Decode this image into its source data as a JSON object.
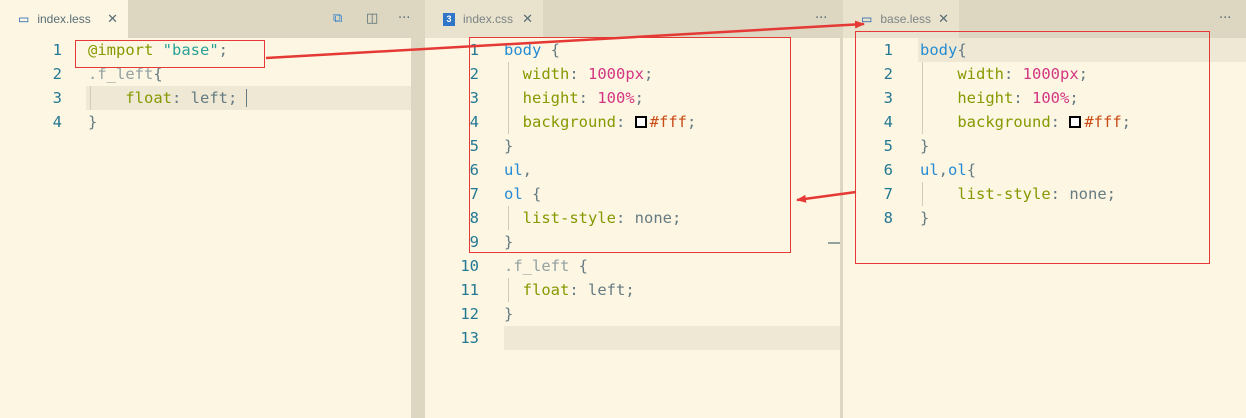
{
  "panes": [
    {
      "tab": {
        "label": "index.less",
        "icon": "less-file-icon"
      },
      "actions": [
        "compare-icon",
        "split-editor-icon",
        "more-actions-icon"
      ],
      "lines": [
        {
          "n": "1",
          "tokens": [
            [
              "at",
              "@import"
            ],
            [
              "plain",
              " "
            ],
            [
              "str",
              "\"base\""
            ],
            [
              "plain",
              ";"
            ]
          ]
        },
        {
          "n": "2",
          "tokens": [
            [
              "cls",
              ".f_left"
            ],
            [
              "plain",
              "{"
            ]
          ]
        },
        {
          "n": "3",
          "tokens": [
            [
              "plain",
              "    "
            ],
            [
              "prop",
              "float"
            ],
            [
              "plain",
              ": left;"
            ]
          ]
        },
        {
          "n": "4",
          "tokens": [
            [
              "plain",
              "}"
            ]
          ]
        }
      ]
    },
    {
      "tab": {
        "label": "index.css",
        "icon": "css-file-icon"
      },
      "actions": [
        "more-actions-icon"
      ],
      "lines": [
        {
          "n": "1",
          "tokens": [
            [
              "kw",
              "body"
            ],
            [
              "plain",
              " {"
            ]
          ]
        },
        {
          "n": "2",
          "tokens": [
            [
              "plain",
              "  "
            ],
            [
              "prop",
              "width"
            ],
            [
              "plain",
              ": "
            ],
            [
              "num",
              "1000px"
            ],
            [
              "plain",
              ";"
            ]
          ]
        },
        {
          "n": "3",
          "tokens": [
            [
              "plain",
              "  "
            ],
            [
              "prop",
              "height"
            ],
            [
              "plain",
              ": "
            ],
            [
              "num",
              "100%"
            ],
            [
              "plain",
              ";"
            ]
          ]
        },
        {
          "n": "4",
          "tokens": [
            [
              "plain",
              "  "
            ],
            [
              "prop",
              "background"
            ],
            [
              "plain",
              ": "
            ],
            [
              "swatch",
              ""
            ],
            [
              "hex",
              "#fff"
            ],
            [
              "plain",
              ";"
            ]
          ]
        },
        {
          "n": "5",
          "tokens": [
            [
              "plain",
              "}"
            ]
          ]
        },
        {
          "n": "6",
          "tokens": [
            [
              "kw",
              "ul"
            ],
            [
              "plain",
              ","
            ]
          ]
        },
        {
          "n": "7",
          "tokens": [
            [
              "kw",
              "ol"
            ],
            [
              "plain",
              " {"
            ]
          ]
        },
        {
          "n": "8",
          "tokens": [
            [
              "plain",
              "  "
            ],
            [
              "prop",
              "list-style"
            ],
            [
              "plain",
              ": none;"
            ]
          ]
        },
        {
          "n": "9",
          "tokens": [
            [
              "plain",
              "}"
            ]
          ]
        },
        {
          "n": "10",
          "tokens": [
            [
              "cls",
              ".f_left"
            ],
            [
              "plain",
              " {"
            ]
          ]
        },
        {
          "n": "11",
          "tokens": [
            [
              "plain",
              "  "
            ],
            [
              "prop",
              "float"
            ],
            [
              "plain",
              ": left;"
            ]
          ]
        },
        {
          "n": "12",
          "tokens": [
            [
              "plain",
              "}"
            ]
          ]
        },
        {
          "n": "13",
          "tokens": []
        }
      ]
    },
    {
      "tab": {
        "label": "base.less",
        "icon": "less-file-icon"
      },
      "actions": [
        "more-actions-icon"
      ],
      "lines": [
        {
          "n": "1",
          "tokens": [
            [
              "kw",
              "body"
            ],
            [
              "plain",
              "{"
            ]
          ]
        },
        {
          "n": "2",
          "tokens": [
            [
              "plain",
              "    "
            ],
            [
              "prop",
              "width"
            ],
            [
              "plain",
              ": "
            ],
            [
              "num",
              "1000px"
            ],
            [
              "plain",
              ";"
            ]
          ]
        },
        {
          "n": "3",
          "tokens": [
            [
              "plain",
              "    "
            ],
            [
              "prop",
              "height"
            ],
            [
              "plain",
              ": "
            ],
            [
              "num",
              "100%"
            ],
            [
              "plain",
              ";"
            ]
          ]
        },
        {
          "n": "4",
          "tokens": [
            [
              "plain",
              "    "
            ],
            [
              "prop",
              "background"
            ],
            [
              "plain",
              ": "
            ],
            [
              "swatch",
              ""
            ],
            [
              "hex",
              "#fff"
            ],
            [
              "plain",
              ";"
            ]
          ]
        },
        {
          "n": "5",
          "tokens": [
            [
              "plain",
              "}"
            ]
          ]
        },
        {
          "n": "6",
          "tokens": [
            [
              "kw",
              "ul"
            ],
            [
              "plain",
              ","
            ],
            [
              "kw",
              "ol"
            ],
            [
              "plain",
              "{"
            ]
          ]
        },
        {
          "n": "7",
          "tokens": [
            [
              "plain",
              "    "
            ],
            [
              "prop",
              "list-style"
            ],
            [
              "plain",
              ": none;"
            ]
          ]
        },
        {
          "n": "8",
          "tokens": [
            [
              "plain",
              "}"
            ]
          ]
        }
      ]
    }
  ],
  "glyphs": {
    "close": "✕",
    "more": "···",
    "compare": "⧉",
    "split": "◫",
    "file": "▭",
    "css_file": "3"
  },
  "colors": {
    "annotation": "#e53935",
    "line_number": "#237893",
    "keyword": "#268bd2",
    "property": "#859900",
    "number": "#d33682",
    "string": "#2aa198"
  }
}
